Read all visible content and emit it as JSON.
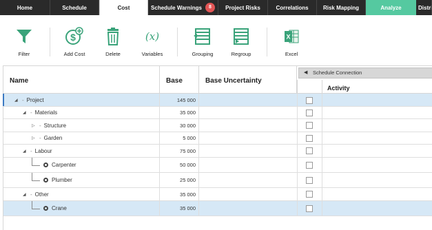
{
  "tabs": [
    {
      "label": "Home",
      "style": "dark"
    },
    {
      "label": "Schedule",
      "style": "dark"
    },
    {
      "label": "Cost",
      "style": "active"
    },
    {
      "label": "Schedule Warnings",
      "style": "dark",
      "badge": "8"
    },
    {
      "label": "Project Risks",
      "style": "dark"
    },
    {
      "label": "Correlations",
      "style": "dark"
    },
    {
      "label": "Risk Mapping",
      "style": "dark"
    },
    {
      "label": "Analyze",
      "style": "analyze"
    },
    {
      "label": "Distri",
      "style": "dark"
    }
  ],
  "toolbar": {
    "filter": "Filter",
    "add_cost": "Add Cost",
    "delete": "Delete",
    "variables": "Variables",
    "grouping": "Grouping",
    "regroup": "Regroup",
    "excel": "Excel"
  },
  "columns": {
    "name": "Name",
    "base": "Base",
    "base_uncertainty": "Base Uncertainty",
    "schedule_connection": "Schedule Connection",
    "activity": "Activity"
  },
  "rows": [
    {
      "name": "Project",
      "base": "145 000"
    },
    {
      "name": "Materials",
      "base": "35 000"
    },
    {
      "name": "Structure",
      "base": "30 000"
    },
    {
      "name": "Garden",
      "base": "5 000"
    },
    {
      "name": "Labour",
      "base": "75 000"
    },
    {
      "name": "Carpenter",
      "base": "50 000"
    },
    {
      "name": "Plumber",
      "base": "25 000"
    },
    {
      "name": "Other",
      "base": "35 000"
    },
    {
      "name": "Crane",
      "base": "35 000"
    }
  ],
  "colors": {
    "tab_dark": "#2a2a2a",
    "tab_analyze": "#55c9a0",
    "icon_green": "#3aa37a",
    "selected_row": "#d6e8f6",
    "badge": "#e25555"
  }
}
